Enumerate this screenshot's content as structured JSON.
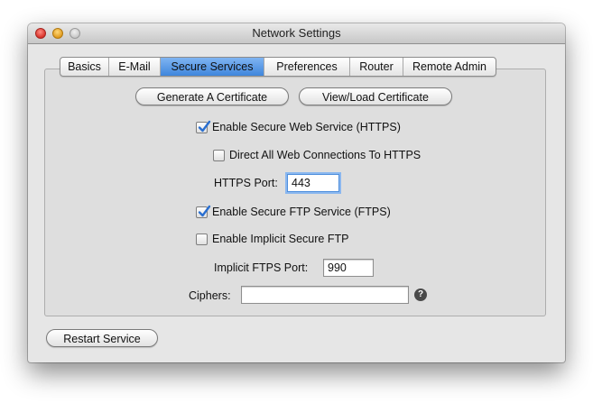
{
  "window": {
    "title": "Network Settings"
  },
  "tabs": [
    {
      "label": "Basics",
      "selected": false
    },
    {
      "label": "E-Mail",
      "selected": false
    },
    {
      "label": "Secure Services",
      "selected": true
    },
    {
      "label": "Preferences",
      "selected": false
    },
    {
      "label": "Router",
      "selected": false
    },
    {
      "label": "Remote Admin",
      "selected": false
    }
  ],
  "buttons": {
    "generate_certificate": "Generate A Certificate",
    "view_load_certificate": "View/Load Certificate",
    "restart_service": "Restart Service"
  },
  "options": {
    "https_enable": {
      "label": "Enable Secure Web Service (HTTPS)",
      "checked": true
    },
    "direct_https": {
      "label": "Direct All Web Connections To HTTPS",
      "checked": false
    },
    "https_port": {
      "label": "HTTPS Port:",
      "value": "443"
    },
    "ftps_enable": {
      "label": "Enable Secure FTP Service (FTPS)",
      "checked": true
    },
    "implicit_ftp": {
      "label": "Enable Implicit Secure FTP",
      "checked": false
    },
    "implicit_port": {
      "label": "Implicit FTPS Port:",
      "value": "990"
    },
    "ciphers": {
      "label": "Ciphers:",
      "value": ""
    }
  },
  "icons": {
    "help": "question-mark-help-icon",
    "check": "checkmark-icon"
  },
  "colors": {
    "accent": "#3f86dc",
    "checkmark": "#2a6fd0"
  }
}
